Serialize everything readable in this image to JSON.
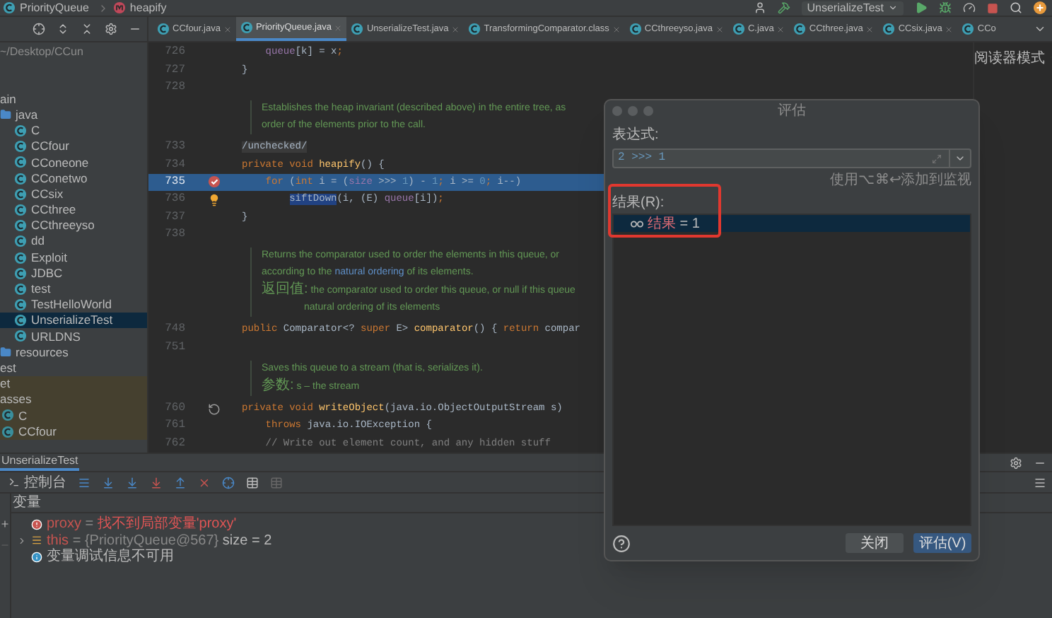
{
  "breadcrumb": [
    {
      "label": "PriorityQueue",
      "kind": "class"
    },
    {
      "label": "heapify",
      "kind": "method"
    }
  ],
  "run_config": {
    "label": "UnserializeTest"
  },
  "tabs": [
    {
      "label": "CCfour.java",
      "selected": false
    },
    {
      "label": "PriorityQueue.java",
      "selected": true
    },
    {
      "label": "UnserializeTest.java",
      "selected": false
    },
    {
      "label": "TransformingComparator.class",
      "selected": false
    },
    {
      "label": "CCthreeyso.java",
      "selected": false
    },
    {
      "label": "C.java",
      "selected": false
    },
    {
      "label": "CCthree.java",
      "selected": false
    },
    {
      "label": "CCsix.java",
      "selected": false
    },
    {
      "label": "CCo",
      "selected": false
    }
  ],
  "sidebar": {
    "path": "~/Desktop/CCun",
    "items": [
      {
        "label": "ain",
        "kind": "text",
        "selected": false,
        "excluded": false
      },
      {
        "label": "java",
        "kind": "folder",
        "selected": false,
        "excluded": false
      },
      {
        "label": "C",
        "kind": "class",
        "selected": false,
        "excluded": false
      },
      {
        "label": "CCfour",
        "kind": "class",
        "selected": false,
        "excluded": false
      },
      {
        "label": "CConeone",
        "kind": "class",
        "selected": false,
        "excluded": false
      },
      {
        "label": "CConetwo",
        "kind": "class",
        "selected": false,
        "excluded": false
      },
      {
        "label": "CCsix",
        "kind": "class",
        "selected": false,
        "excluded": false
      },
      {
        "label": "CCthree",
        "kind": "class",
        "selected": false,
        "excluded": false
      },
      {
        "label": "CCthreeyso",
        "kind": "class",
        "selected": false,
        "excluded": false
      },
      {
        "label": "dd",
        "kind": "class",
        "selected": false,
        "excluded": false
      },
      {
        "label": "Exploit",
        "kind": "class",
        "selected": false,
        "excluded": false
      },
      {
        "label": "JDBC",
        "kind": "class",
        "selected": false,
        "excluded": false
      },
      {
        "label": "test",
        "kind": "class",
        "selected": false,
        "excluded": false
      },
      {
        "label": "TestHelloWorld",
        "kind": "class",
        "selected": false,
        "excluded": false
      },
      {
        "label": "UnserializeTest",
        "kind": "class",
        "selected": true,
        "excluded": false
      },
      {
        "label": "URLDNS",
        "kind": "class",
        "selected": false,
        "excluded": false
      },
      {
        "label": "resources",
        "kind": "folder",
        "selected": false,
        "excluded": false
      },
      {
        "label": "est",
        "kind": "text",
        "selected": false,
        "excluded": false
      },
      {
        "label": "et",
        "kind": "text",
        "selected": false,
        "excluded": true
      },
      {
        "label": "asses",
        "kind": "text",
        "selected": false,
        "excluded": true
      },
      {
        "label": "C",
        "kind": "class",
        "selected": false,
        "excluded": true
      },
      {
        "label": "CCfour",
        "kind": "class",
        "selected": false,
        "excluded": true
      }
    ]
  },
  "editor": {
    "reader_mode": "阅读器模式",
    "lines": [
      {
        "kind": "code",
        "number": "726",
        "highlighted": false,
        "breakpoint": false,
        "bulb": false,
        "override": false,
        "segments": [
          {
            "kind": "field",
            "text": "    queue"
          },
          {
            "kind": "plain",
            "text": "[k] = x"
          },
          {
            "kind": "keyword",
            "text": ";"
          }
        ]
      },
      {
        "kind": "code",
        "number": "727",
        "highlighted": false,
        "breakpoint": false,
        "bulb": false,
        "override": false,
        "segments": [
          {
            "kind": "plain",
            "text": "}"
          }
        ]
      },
      {
        "kind": "code",
        "number": "728",
        "highlighted": false,
        "breakpoint": false,
        "bulb": false,
        "override": false
      },
      {
        "kind": "doc",
        "lines": [
          {
            "kind": "line",
            "segments": [
              {
                "kind": "doc",
                "text": "Establishes the heap invariant (described above) in the entire tree, as"
              }
            ]
          },
          {
            "kind": "line",
            "segments": [
              {
                "kind": "doc",
                "text": "order of the elements prior to the call."
              }
            ]
          }
        ]
      },
      {
        "kind": "code",
        "number": "733",
        "highlighted": false,
        "breakpoint": false,
        "bulb": false,
        "override": false,
        "segments": [
          {
            "kind": "annotation",
            "text": "/unchecked/"
          }
        ]
      },
      {
        "kind": "code",
        "number": "734",
        "highlighted": false,
        "breakpoint": false,
        "bulb": false,
        "override": false,
        "segments": [
          {
            "kind": "keyword",
            "text": "private void "
          },
          {
            "kind": "method",
            "text": "heapify"
          },
          {
            "kind": "plain",
            "text": "() {"
          }
        ]
      },
      {
        "kind": "code",
        "number": "735",
        "highlighted": true,
        "breakpoint": true,
        "bulb": false,
        "override": false,
        "segments": [
          {
            "kind": "keyword",
            "text": "    for "
          },
          {
            "kind": "plain",
            "text": "("
          },
          {
            "kind": "keyword",
            "text": "int "
          },
          {
            "kind": "plain",
            "text": "i = ("
          },
          {
            "kind": "field",
            "text": "size"
          },
          {
            "kind": "plain",
            "text": " >>> "
          },
          {
            "kind": "number",
            "text": "1"
          },
          {
            "kind": "plain",
            "text": ") - "
          },
          {
            "kind": "number",
            "text": "1"
          },
          {
            "kind": "keyword",
            "text": "; "
          },
          {
            "kind": "plain",
            "text": "i >= "
          },
          {
            "kind": "number",
            "text": "0"
          },
          {
            "kind": "keyword",
            "text": "; "
          },
          {
            "kind": "plain",
            "text": "i--)"
          }
        ]
      },
      {
        "kind": "code",
        "number": "736",
        "highlighted": false,
        "breakpoint": false,
        "bulb": true,
        "override": false,
        "segments": [
          {
            "kind": "selected",
            "text": "        siftDown"
          },
          {
            "kind": "plain",
            "text": "(i, (E) "
          },
          {
            "kind": "field",
            "text": "queue"
          },
          {
            "kind": "plain",
            "text": "[i])"
          },
          {
            "kind": "keyword",
            "text": ";"
          }
        ]
      },
      {
        "kind": "code",
        "number": "737",
        "highlighted": false,
        "breakpoint": false,
        "bulb": false,
        "override": false,
        "segments": [
          {
            "kind": "plain",
            "text": "}"
          }
        ]
      },
      {
        "kind": "code",
        "number": "738",
        "highlighted": false,
        "breakpoint": false,
        "bulb": false,
        "override": false
      },
      {
        "kind": "doc",
        "lines": [
          {
            "kind": "line",
            "segments": [
              {
                "kind": "doc",
                "text": "Returns the comparator used to order the elements in this queue, or"
              }
            ]
          },
          {
            "kind": "line",
            "segments": [
              {
                "kind": "doc",
                "text": "according to the "
              },
              {
                "kind": "link",
                "text": "natural ordering"
              },
              {
                "kind": "doc",
                "text": " of its elements."
              }
            ]
          },
          {
            "kind": "line",
            "segments": [
              {
                "kind": "label",
                "text": "返回值:"
              },
              {
                "kind": "doc",
                "text": " the comparator used to order this queue, or null if this queue"
              }
            ]
          },
          {
            "kind": "continuation",
            "segments": [
              {
                "kind": "doc",
                "text": "natural ordering of its elements"
              }
            ]
          }
        ]
      },
      {
        "kind": "code",
        "number": "748",
        "highlighted": false,
        "breakpoint": false,
        "bulb": false,
        "override": false,
        "segments": [
          {
            "kind": "keyword",
            "text": "public "
          },
          {
            "kind": "plain",
            "text": "Comparator<? "
          },
          {
            "kind": "keyword",
            "text": "super "
          },
          {
            "kind": "plain",
            "text": "E> "
          },
          {
            "kind": "method",
            "text": "comparator"
          },
          {
            "kind": "plain",
            "text": "() { "
          },
          {
            "kind": "keyword",
            "text": "return "
          },
          {
            "kind": "plain",
            "text": "compar"
          }
        ]
      },
      {
        "kind": "code",
        "number": "751",
        "highlighted": false,
        "breakpoint": false,
        "bulb": false,
        "override": false
      },
      {
        "kind": "doc",
        "lines": [
          {
            "kind": "line",
            "segments": [
              {
                "kind": "doc",
                "text": "Saves this queue to a stream (that is, serializes it)."
              }
            ]
          },
          {
            "kind": "line",
            "segments": [
              {
                "kind": "label",
                "text": "参数:"
              },
              {
                "kind": "doc",
                "text": " s – the stream"
              }
            ]
          }
        ]
      },
      {
        "kind": "code",
        "number": "760",
        "highlighted": false,
        "breakpoint": false,
        "bulb": false,
        "override": true,
        "segments": [
          {
            "kind": "keyword",
            "text": "private void "
          },
          {
            "kind": "method",
            "text": "writeObject"
          },
          {
            "kind": "plain",
            "text": "(java.io.ObjectOutputStream s)"
          }
        ]
      },
      {
        "kind": "code",
        "number": "761",
        "highlighted": false,
        "breakpoint": false,
        "bulb": false,
        "override": false,
        "segments": [
          {
            "kind": "keyword",
            "text": "    throws "
          },
          {
            "kind": "plain",
            "text": "java.io.IOException {"
          }
        ]
      },
      {
        "kind": "code",
        "number": "762",
        "highlighted": false,
        "breakpoint": false,
        "bulb": false,
        "override": false,
        "segments": [
          {
            "kind": "comment",
            "text": "    // Write out element count, and any hidden stuff"
          }
        ]
      }
    ]
  },
  "debug_panel": {
    "tab": "UnserializeTest",
    "console": "控制台",
    "variables_header": "变量",
    "variables": [
      {
        "kind": "error",
        "name": "proxy",
        "separator": "=",
        "value": "找不到局部变量'proxy'"
      },
      {
        "kind": "object",
        "name": "this",
        "separator": "=",
        "value": "{PriorityQueue@567}",
        "extra": "size = 2"
      },
      {
        "kind": "info",
        "value": "变量调试信息不可用"
      }
    ]
  },
  "dialog": {
    "title": "评估",
    "expression_label": "表达式:",
    "expression": "2 >>> 1",
    "hint": "使用⌥⌘↩添加到监视",
    "result_label": "结果(R):",
    "result": {
      "name": "结果",
      "value": "= 1"
    },
    "buttons": [
      {
        "label": "关闭",
        "kind": "secondary"
      },
      {
        "label": "评估(V)",
        "kind": "primary"
      }
    ]
  }
}
